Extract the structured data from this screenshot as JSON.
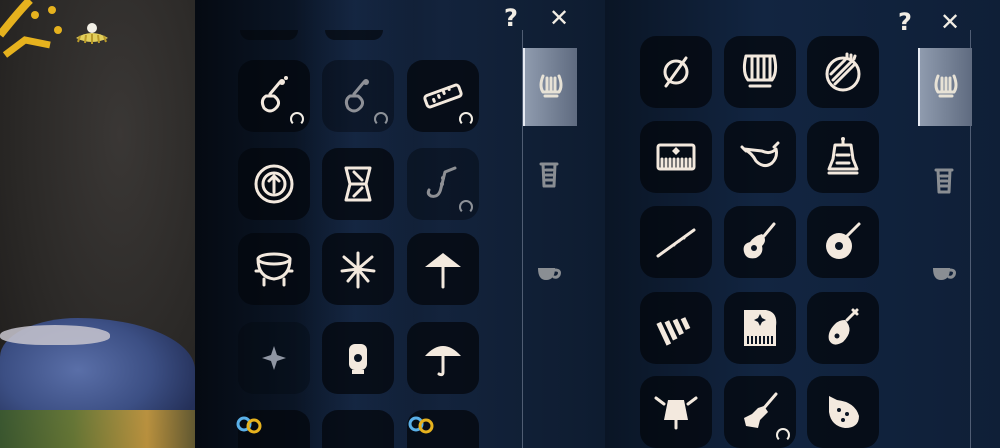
{
  "left_panel": {
    "help_label": "?",
    "close_label": "✕",
    "tabs": [
      {
        "icon": "lyre-icon",
        "active": true
      },
      {
        "icon": "trash-can-icon",
        "active": false
      },
      {
        "icon": "cup-icon",
        "active": false
      }
    ],
    "slots": [
      {
        "icon": "violin-icon",
        "owned": true
      },
      {
        "icon": "violin-icon",
        "owned": true,
        "dim": true
      },
      {
        "icon": "harmonica-icon",
        "owned": true
      },
      {
        "icon": "hand-drum-icon",
        "owned": false
      },
      {
        "icon": "tall-drum-icon",
        "owned": false
      },
      {
        "icon": "saxophone-icon",
        "owned": true,
        "dim": true
      },
      {
        "icon": "cauldron-icon",
        "owned": false
      },
      {
        "icon": "firework-icon",
        "owned": false
      },
      {
        "icon": "parasol-icon",
        "owned": false
      },
      {
        "icon": "sparkle-icon",
        "owned": false
      },
      {
        "icon": "lantern-icon",
        "owned": false
      },
      {
        "icon": "umbrella-icon",
        "owned": false
      }
    ]
  },
  "right_panel": {
    "help_label": "?",
    "close_label": "✕",
    "tabs": [
      {
        "icon": "lyre-icon",
        "active": true
      },
      {
        "icon": "trash-can-icon",
        "active": false
      },
      {
        "icon": "cup-icon",
        "active": false
      }
    ],
    "slots": [
      {
        "icon": "none-icon",
        "owned": false
      },
      {
        "icon": "lyre-icon",
        "owned": false
      },
      {
        "icon": "handpan-icon",
        "owned": false
      },
      {
        "icon": "keyboard-icon",
        "owned": false
      },
      {
        "icon": "horn-icon",
        "owned": false
      },
      {
        "icon": "bell-icon",
        "owned": false
      },
      {
        "icon": "flute-icon",
        "owned": false
      },
      {
        "icon": "guitar-icon",
        "owned": false
      },
      {
        "icon": "mandolin-icon",
        "owned": false
      },
      {
        "icon": "xylophone-icon",
        "owned": false
      },
      {
        "icon": "piano-icon",
        "owned": false
      },
      {
        "icon": "pipa-icon",
        "owned": false
      },
      {
        "icon": "winged-bell-icon",
        "owned": false
      },
      {
        "icon": "electric-guitar-icon",
        "owned": true
      },
      {
        "icon": "ocarina-icon",
        "owned": false
      }
    ]
  }
}
